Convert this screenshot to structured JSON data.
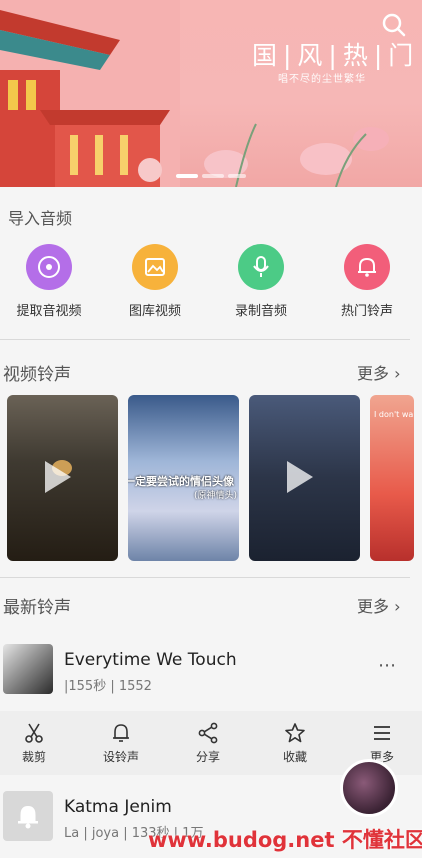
{
  "banner": {
    "title": "国|风|热|门",
    "subtitle": "唱不尽的尘世繁华"
  },
  "import_audio": {
    "title": "导入音频",
    "items": [
      {
        "label": "提取音视频",
        "icon": "music-disc-icon",
        "color": "#b46ee8"
      },
      {
        "label": "图库视频",
        "icon": "image-icon",
        "color": "#f7b23b"
      },
      {
        "label": "录制音频",
        "icon": "microphone-icon",
        "color": "#4ccb86"
      },
      {
        "label": "热门铃声",
        "icon": "bell-icon",
        "color": "#f25e7a"
      }
    ]
  },
  "video_ringtones": {
    "title": "视频铃声",
    "more": "更多",
    "cards": [
      {
        "caption": ""
      },
      {
        "caption": "一定要尝试的情侣头像",
        "sub": "(原神情头)"
      },
      {
        "caption": ""
      },
      {
        "caption": "I don't wan"
      }
    ]
  },
  "latest_ringtones": {
    "title": "最新铃声",
    "more": "更多",
    "songs": [
      {
        "title": "Everytime We Touch",
        "meta": "|155秒 | 1552"
      },
      {
        "title": "Katma Jenim",
        "meta": "La | joya | 133秒 | 1万"
      }
    ]
  },
  "actions": [
    {
      "label": "裁剪",
      "icon": "scissors-icon"
    },
    {
      "label": "设铃声",
      "icon": "bell-outline-icon"
    },
    {
      "label": "分享",
      "icon": "share-icon"
    },
    {
      "label": "收藏",
      "icon": "star-icon"
    },
    {
      "label": "更多",
      "icon": "menu-icon"
    }
  ],
  "watermark": "www.budog.net 不懂社区"
}
